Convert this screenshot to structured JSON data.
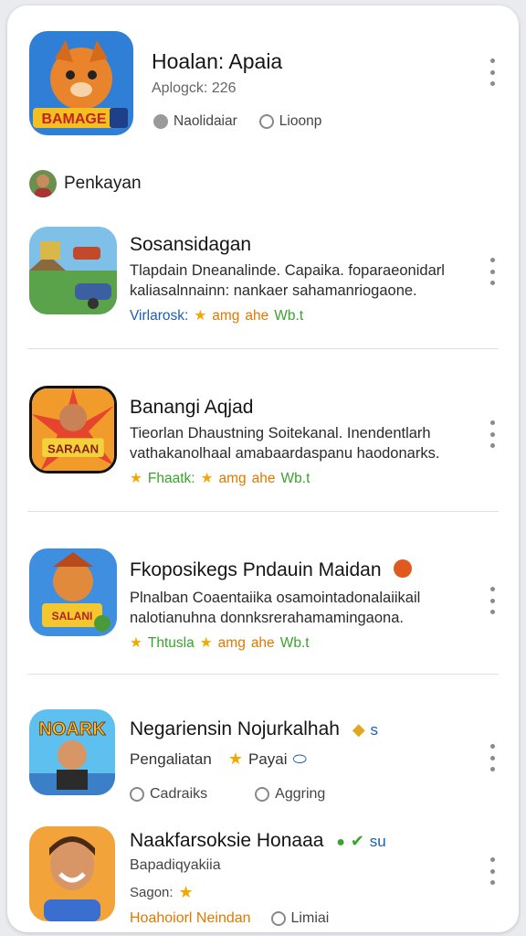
{
  "header": {
    "app_name": "Hoalan: Apaia",
    "subtitle": "Aplogck: 226",
    "tag1": "Naolidaiar",
    "tag2": "Lioonp"
  },
  "section": {
    "title": "Penkayan"
  },
  "items": [
    {
      "title": "Sosansidagan",
      "desc1": "Tlapdain Dneanalinde. Capaika. foparaeonidarl",
      "desc2": "kaliasalnnainn: nankaer sahamanriogaone.",
      "meta_a": "Virlarosk:",
      "meta_b": "amg",
      "meta_c": "ahe",
      "meta_d": "Wb.t"
    },
    {
      "title": "Banangi Aqjad",
      "desc1": "Tieorlan Dhaustning Soitekanal. Inendentlarh",
      "desc2": "vathakanolhaal amabaardaspanu haodonarks.",
      "meta_a": "Fhaatk:",
      "meta_b": "amg",
      "meta_c": "ahe",
      "meta_d": "Wb.t"
    },
    {
      "title": "Fkoposikegs Pndauin Maidan",
      "desc1": "Plnalban Coaentaiika osamointadonalaiikail",
      "desc2": "nalotianuhna donnksrerahamamingaona.",
      "meta_a": "Thtusla",
      "meta_b": "amg",
      "meta_c": "ahe",
      "meta_d": "Wb.t"
    },
    {
      "title": "Negariensin Nojurkalhah",
      "suffix": "s",
      "line2a": "Pengaliatan",
      "line2b": "Payai",
      "line3a": "Cadraiks",
      "line3b": "Aggring"
    },
    {
      "title": "Naakfarsoksie Honaaa",
      "suffix": "su",
      "line2": "Bapadiqyakiia",
      "line3": "Sagon:",
      "line4a": "Hoahoiorl Neindan",
      "line4b": "Limiai"
    }
  ],
  "colors": {
    "star": "#f2a800",
    "meta_blue": "#1a5fb4",
    "meta_green": "#3aa32e",
    "meta_orange": "#e07800"
  }
}
